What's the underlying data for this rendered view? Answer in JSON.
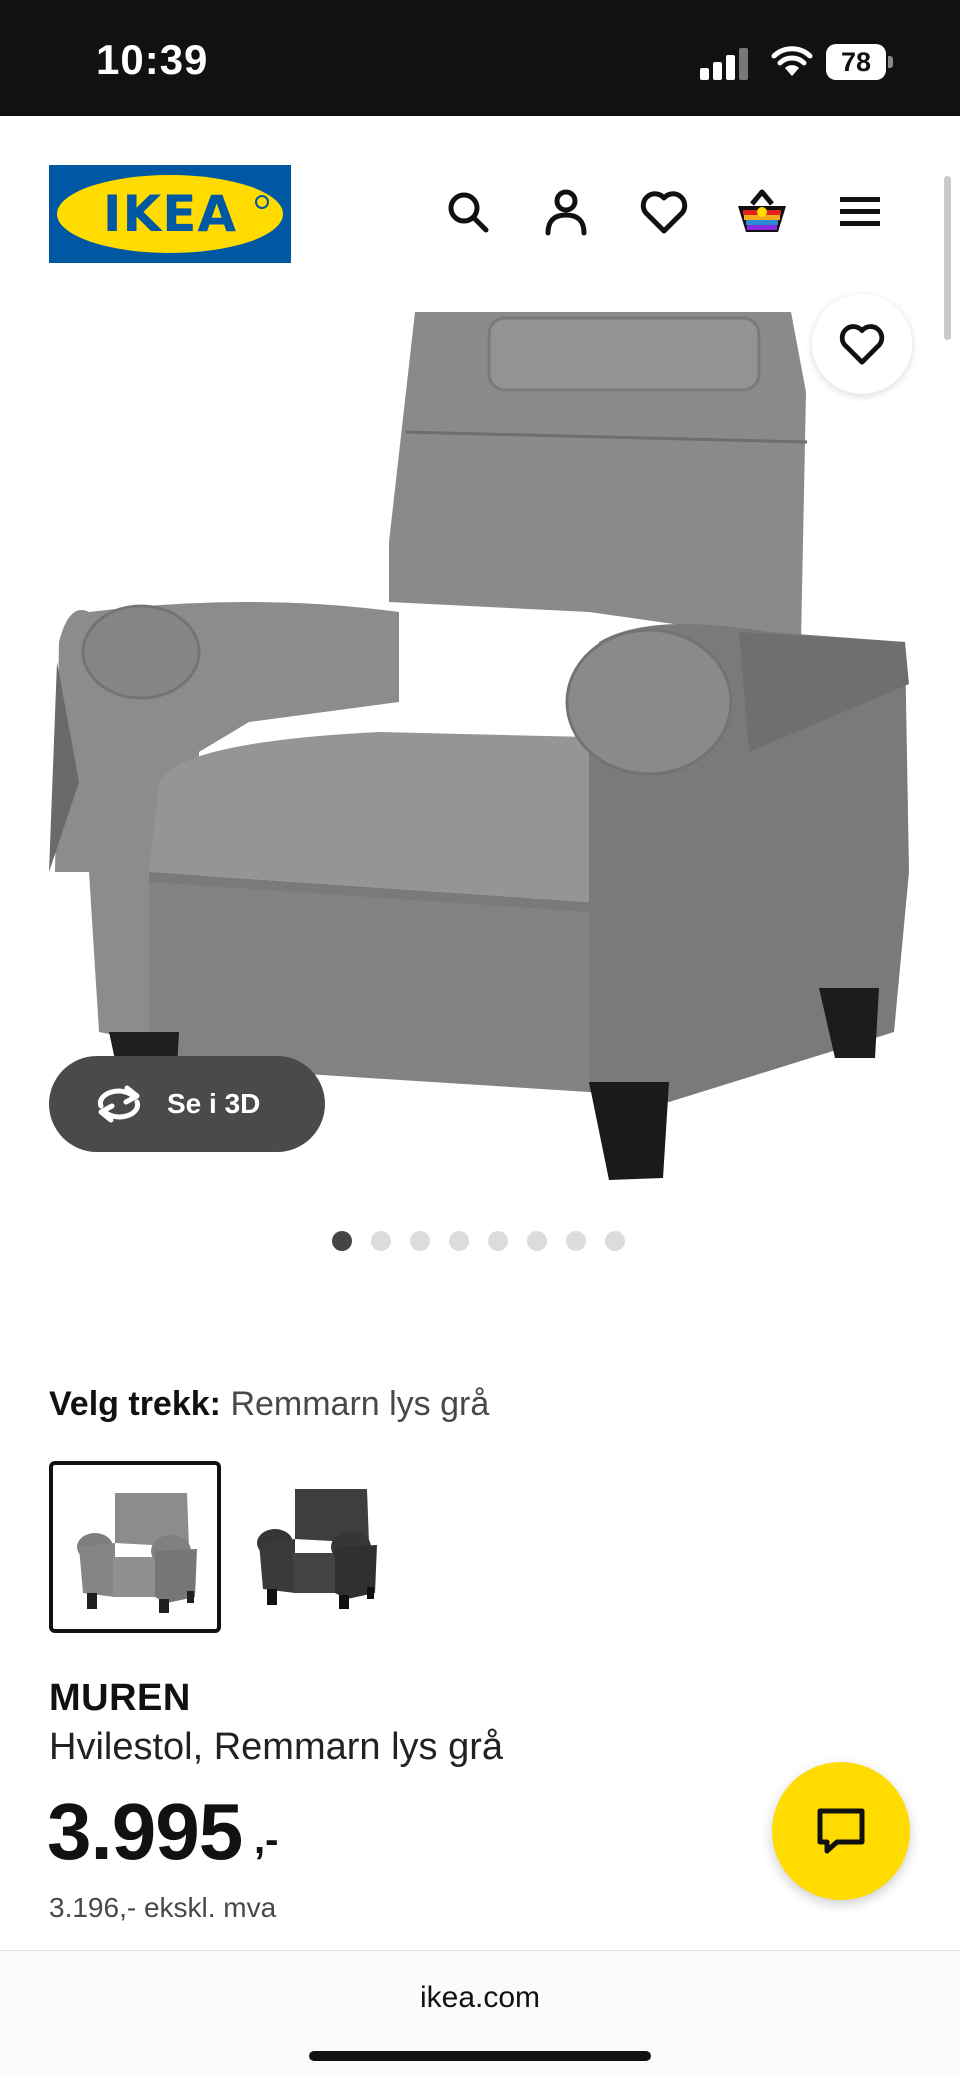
{
  "status_bar": {
    "time": "10:39",
    "battery": "78",
    "icons": [
      "signal-icon",
      "wifi-icon",
      "battery-icon"
    ]
  },
  "header": {
    "logo_text": "IKEA",
    "icons": [
      "search-icon",
      "account-icon",
      "favorites-icon",
      "cart-icon",
      "menu-icon"
    ]
  },
  "product_media": {
    "view_3d_label": "Se i 3D",
    "image_count": 8,
    "active_image": 1
  },
  "variant": {
    "label": "Velg trekk:",
    "selected": "Remmarn lys grå",
    "swatches": [
      {
        "name": "Remmarn lys grå",
        "color": "#7a7a7a",
        "selected": true
      },
      {
        "name": "dark",
        "color": "#3c3c3c",
        "selected": false
      }
    ]
  },
  "product": {
    "name": "MUREN",
    "description": "Hvilestol, Remmarn lys grå",
    "price": "3.995",
    "price_suffix": ",-",
    "price_ex_vat": "3.196,- ekskl. mva"
  },
  "browser": {
    "url": "ikea.com"
  },
  "colors": {
    "ikea_blue": "#0058a3",
    "ikea_yellow": "#ffdb00",
    "chair_gray": "#7d7d7d"
  }
}
